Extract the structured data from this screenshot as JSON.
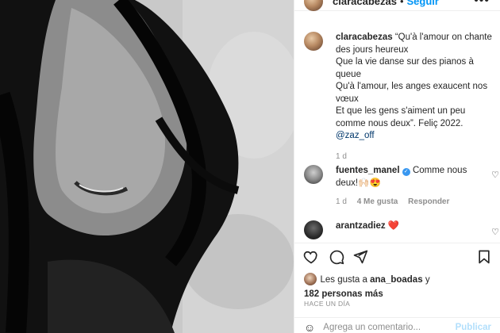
{
  "post": {
    "username": "claracabezas",
    "separator": "•",
    "follow_label": "Seguir",
    "more_label": "•••"
  },
  "caption": {
    "username": "claracabezas",
    "lines": [
      "“Qu'à l'amour on chante des jours heureux",
      "Que la vie danse sur des pianos à queue",
      "Qu'à l'amour, les anges exaucent nos vœux",
      "Et que les gens s'aiment un peu comme nous deux”. Feliç 2022."
    ],
    "mention": "@zaz_off",
    "time": "1 d"
  },
  "comments": [
    {
      "username": "fuentes_manel",
      "verified": true,
      "text": "Comme nous deux!🙌🏻😍",
      "time": "1 d",
      "likes": "4 Me gusta",
      "reply": "Responder"
    },
    {
      "username": "arantzadiez",
      "verified": false,
      "text": "❤️"
    }
  ],
  "likes": {
    "prefix": "Les gusta a",
    "user": "ana_boadas",
    "conj": "y",
    "others": "182 personas más"
  },
  "timestamp": "HACE UN DÍA",
  "add_comment": {
    "placeholder": "Agrega un comentario...",
    "publish": "Publicar",
    "emoji": "☺"
  },
  "icons": {
    "like": "heart-icon",
    "comment": "comment-icon",
    "share": "share-icon",
    "save": "bookmark-icon"
  },
  "colors": {
    "follow": "#0095f6",
    "verified": "#3897f0",
    "muted": "#8e8e8e",
    "publish_disabled": "#b2dffc"
  }
}
